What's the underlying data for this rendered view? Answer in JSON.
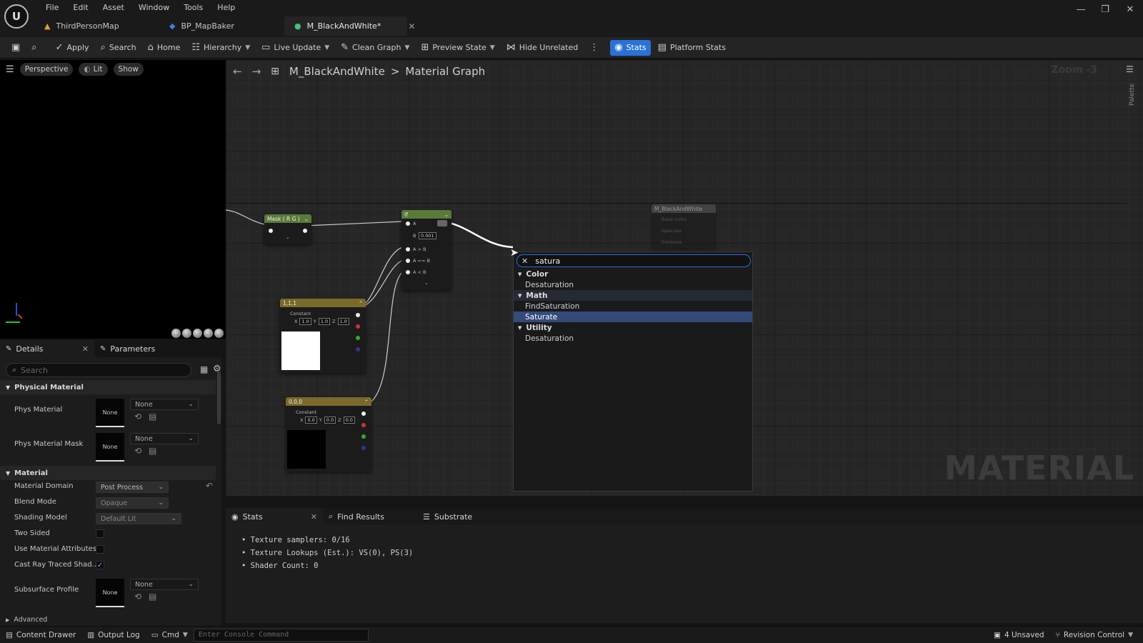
{
  "menu": [
    "File",
    "Edit",
    "Asset",
    "Window",
    "Tools",
    "Help"
  ],
  "tabs": [
    {
      "label": "ThirdPersonMap",
      "icon": "level-icon"
    },
    {
      "label": "BP_MapBaker",
      "icon": "blueprint-icon"
    },
    {
      "label": "M_BlackAndWhite*",
      "icon": "material-icon",
      "active": true
    }
  ],
  "toolbar": {
    "apply": "Apply",
    "search": "Search",
    "home": "Home",
    "hierarchy": "Hierarchy",
    "live_update": "Live Update",
    "clean_graph": "Clean Graph",
    "preview_state": "Preview State",
    "hide_unrelated": "Hide Unrelated",
    "stats": "Stats",
    "platform_stats": "Platform Stats"
  },
  "viewport": {
    "perspective": "Perspective",
    "lit": "Lit",
    "show": "Show"
  },
  "details": {
    "tab_details": "Details",
    "tab_parameters": "Parameters",
    "search_placeholder": "Search",
    "section_physical": "Physical Material",
    "phys_material": "Phys Material",
    "phys_material_mask": "Phys Material Mask",
    "none": "None",
    "section_material": "Material",
    "material_domain": "Material Domain",
    "material_domain_value": "Post Process",
    "blend_mode": "Blend Mode",
    "blend_mode_value": "Opaque",
    "shading_model": "Shading Model",
    "shading_model_value": "Default Lit",
    "two_sided": "Two Sided",
    "use_material_attributes": "Use Material Attributes",
    "cast_ray_traced": "Cast Ray Traced Shad...",
    "subsurface_profile": "Subsurface Profile",
    "advanced": "Advanced"
  },
  "graph": {
    "crumb_root": "M_BlackAndWhite",
    "crumb_sep": ">",
    "crumb_leaf": "Material Graph",
    "zoom": "Zoom -3",
    "palette": "Palette",
    "watermark": "MATERIAL",
    "nodes": {
      "mask": {
        "title": "Mask ( R G )"
      },
      "if": {
        "title": "If",
        "a": "A",
        "b": "B",
        "b_val": "0.001",
        "a_gt_b": "A > B",
        "a_eq_b": "A == B",
        "a_lt_b": "A < B"
      },
      "const1": {
        "title": "1,1,1",
        "label": "Constant",
        "x": "1.0",
        "y": "1.0",
        "z": "1.0"
      },
      "const0": {
        "title": "0,0,0",
        "label": "Constant",
        "x": "0.0",
        "y": "0.0",
        "z": "0.0"
      },
      "result": {
        "title": "M_BlackAndWhite",
        "pin1": "Base Color",
        "pin2": "Specular",
        "pin3": "Emissive"
      }
    }
  },
  "popup": {
    "query": "satura",
    "categories": [
      {
        "name": "Color",
        "items": [
          "Desaturation"
        ]
      },
      {
        "name": "Math",
        "items": [
          "FindSaturation",
          "Saturate"
        ]
      },
      {
        "name": "Utility",
        "items": [
          "Desaturation"
        ]
      }
    ],
    "selected": "Saturate"
  },
  "stats": {
    "tab_stats": "Stats",
    "tab_find": "Find Results",
    "tab_substrate": "Substrate",
    "lines": [
      "Texture samplers: 0/16",
      "Texture Lookups (Est.): VS(0), PS(3)",
      "Shader Count: 0"
    ]
  },
  "statusbar": {
    "content_drawer": "Content Drawer",
    "output_log": "Output Log",
    "cmd": "Cmd",
    "console_placeholder": "Enter Console Command",
    "unsaved": "4 Unsaved",
    "revision_control": "Revision Control"
  },
  "colors": {
    "accent": "#2a72d8",
    "selection": "#344a7a",
    "node_green": "#5a7a3a",
    "node_gold": "#7a6a2a"
  }
}
